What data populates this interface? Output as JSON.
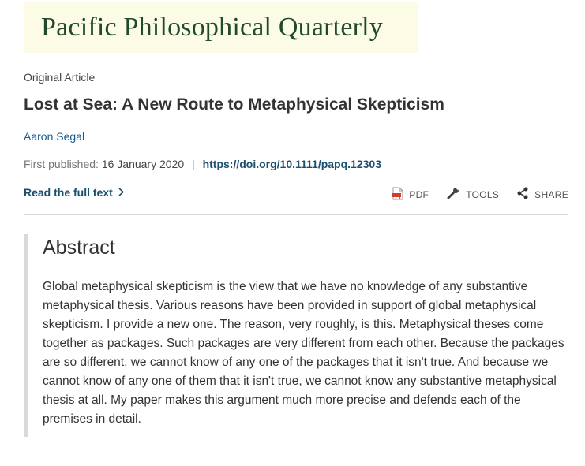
{
  "journal": {
    "title": "Pacific Philosophical Quarterly"
  },
  "article": {
    "type": "Original Article",
    "title": "Lost at Sea: A New Route to Metaphysical Skepticism",
    "author": "Aaron Segal",
    "first_published_label": "First published:",
    "first_published_date": "16 January 2020",
    "separator": "|",
    "doi": "https://doi.org/10.1111/papq.12303"
  },
  "actions": {
    "read_full_text": "Read the full text",
    "read_full_icon": "chevron-right-icon",
    "pdf_label": "PDF",
    "tools_label": "TOOLS",
    "share_label": "SHARE"
  },
  "abstract": {
    "heading": "Abstract",
    "text": "Global metaphysical skepticism is the view that we have no knowledge of any substantive metaphysical thesis. Various reasons have been provided in support of global metaphysical skepticism. I provide a new one. The reason, very roughly, is this. Metaphysical theses come together as packages. Such packages are very different from each other. Because the packages are so different, we cannot know of any one of the packages that it isn't true. And because we cannot know of any one of them that it isn't true, we cannot know any substantive metaphysical thesis at all. My paper makes this argument much more precise and defends each of the premises in detail."
  },
  "colors": {
    "banner_bg": "#fbfbe6",
    "journal_title": "#1f4a2e",
    "link": "#1a4f6e",
    "author_link": "#1a5a8c",
    "pdf_icon": "#d23c2a",
    "divider": "#d9d9d9"
  }
}
